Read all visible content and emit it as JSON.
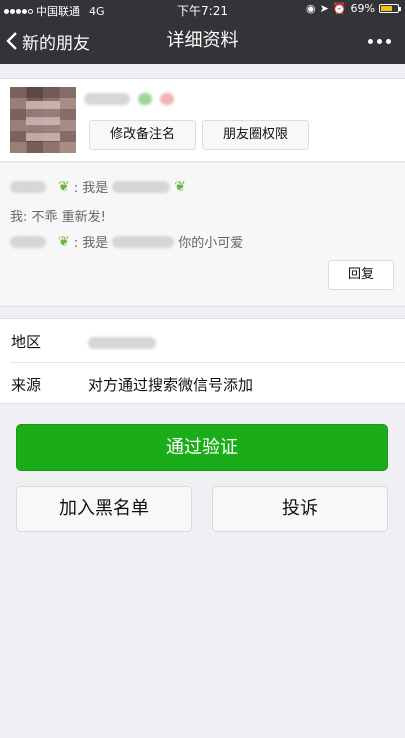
{
  "status_bar": {
    "carrier": "中国联通",
    "network": "4G",
    "time": "下午7:21",
    "battery": "69%",
    "battery_level": 0.69,
    "battery_color": "#f5c21b"
  },
  "nav": {
    "back_label": "新的朋友",
    "title": "详细资料",
    "more_icon": "more-dots-icon"
  },
  "profile": {
    "remark_button": "修改备注名",
    "moments_button": "朋友圈权限"
  },
  "messages": {
    "line1_prefix": ": 我是",
    "line2": "我: 不乖 重新发!",
    "line3_prefix": ": 我是",
    "line3_suffix": "你的小可爱",
    "reply_button": "回复"
  },
  "info": {
    "region_label": "地区",
    "source_label": "来源",
    "source_value": "对方通过搜索微信号添加"
  },
  "actions": {
    "accept": "通过验证",
    "blacklist": "加入黑名单",
    "report": "投诉"
  },
  "colors": {
    "nav_bg": "#333338",
    "accept_green": "#1aad19",
    "page_bg": "#efeff4"
  }
}
